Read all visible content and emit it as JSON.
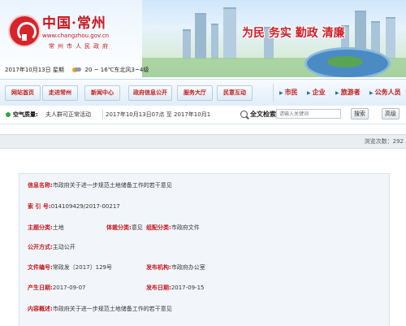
{
  "header": {
    "title": "中国·常州",
    "url": "www.changzhou.gov.cn",
    "subtitle": "常州市人民政府",
    "slogan": "为民 务实 勤政 清廉",
    "date": "2017年10月13日 星期",
    "weather": "20 ~ 16℃东北风3~4级"
  },
  "nav": {
    "items": [
      "网站首页",
      "走进常州",
      "新闻中心",
      "政府信息公开",
      "服务大厅",
      "民意互动"
    ],
    "right_items": [
      "市民",
      "企业",
      "旅游者",
      "公务人员"
    ]
  },
  "infobar": {
    "air_label": "空气质量:",
    "notice": "夫人群可正常活动",
    "ticker": "2017年10月13日07点 至 2017年10月1",
    "search_label": "全文检索:",
    "search_placeholder": "请输入关键词",
    "search_button": "搜索",
    "advanced_button": "高级"
  },
  "views": "浏览次数：292",
  "article": {
    "info_label": "信息名称:",
    "info_value": "市政府关于进一步规范土地储备工作的若干意见",
    "index_label": "索 引 号:",
    "index_value": "014109429/2017-00217",
    "topic_label": "主题分类:",
    "topic_value": "土地",
    "genre_label": "体裁分类:",
    "genre_value": "意见",
    "org_label": "组配分类:",
    "org_value": "市政府文件",
    "mode_label": "公开方式:",
    "mode_value": "主动公开",
    "docno_label": "文件编号:",
    "docno_value": "常政发〔2017〕129号",
    "issuer_label": "发布机构:",
    "issuer_value": "市政府办公室",
    "created_label": "产生日期:",
    "created_value": "2017-09-07",
    "published_label": "发布日期:",
    "published_value": "2017-09-15",
    "summary_label": "内容概述:",
    "summary_value": "市政府关于进一步规范土地储备工作的若干意见"
  }
}
